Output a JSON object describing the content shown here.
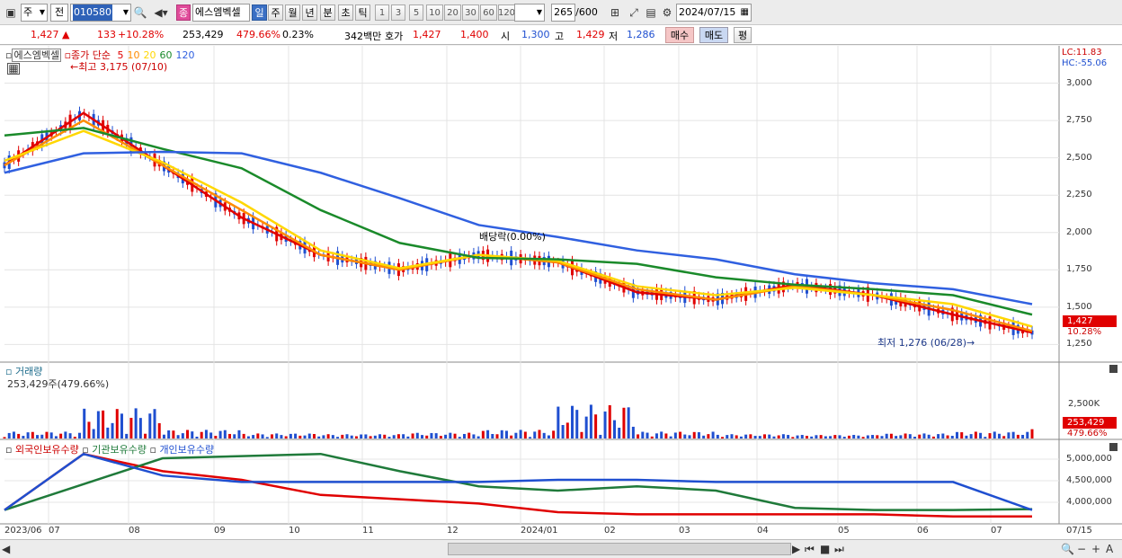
{
  "toolbar": {
    "period_type": "주",
    "prev_label": "전",
    "code": "010580",
    "name_badge": "종",
    "stock_name": "에스엠벡셀",
    "periods": [
      "일",
      "주",
      "월",
      "년",
      "분",
      "초",
      "틱"
    ],
    "selected_period": "일",
    "numbers": [
      "1",
      "3",
      "5",
      "10",
      "20",
      "30",
      "60",
      "120"
    ],
    "count": "265",
    "count_total": "/600",
    "date": "2024/07/15"
  },
  "quote": {
    "price": "1,427",
    "arrow": "▲",
    "change": "133",
    "change_pct": "+10.28%",
    "volume": "253,429",
    "volume_pct": "479.66%",
    "turnover": "0.23%",
    "amount": "342백만",
    "ask_label": "호가",
    "ask": "1,427",
    "bid": "1,400",
    "open_label": "시",
    "open": "1,300",
    "high_label": "고",
    "high": "1,429",
    "low_label": "저",
    "low": "1,286",
    "buy_label": "매수",
    "sell_label": "매도",
    "avg_label": "평"
  },
  "price_panel": {
    "legend_name": "에스엠벡셀",
    "legend_ma": "종가 단순",
    "ma_periods": [
      "5",
      "10",
      "20",
      "60",
      "120"
    ],
    "ma_colors": [
      "#e00000",
      "#ff8c00",
      "#ffd700",
      "#1a8a2a",
      "#3060e0"
    ],
    "high_note": "최고 3,175 (07/10)",
    "low_note": "최저 1,276 (06/28)",
    "div_note": "배당락(0.00%)",
    "lc": "LC:11.83",
    "hc": "HC:-55.06",
    "y_ticks": [
      "3,000",
      "2,750",
      "2,500",
      "2,250",
      "2,000",
      "1,750",
      "1,500",
      "1,250"
    ],
    "price_flag": "1,427",
    "pct_flag": "10.28%"
  },
  "volume_panel": {
    "title": "거래량",
    "value": "253,429주(479.66%)",
    "y_tick": "2,500K",
    "flag": "253,429",
    "flag_pct": "479.66%"
  },
  "holding_panel": {
    "t1": "외국인보유수량",
    "t2": "기관보유수량",
    "t3": "개인보유수량",
    "y_ticks": [
      "5,000,000",
      "4,500,000",
      "4,000,000"
    ]
  },
  "x_labels": [
    "2023/06",
    "07",
    "08",
    "09",
    "10",
    "11",
    "12",
    "2024/01",
    "02",
    "03",
    "04",
    "05",
    "06",
    "07",
    "07/15"
  ],
  "chart_data": {
    "type": "line",
    "x": [
      "2023/06",
      "2023/07",
      "2023/08",
      "2023/09",
      "2023/10",
      "2023/11",
      "2023/12",
      "2024/01",
      "2024/02",
      "2024/03",
      "2024/04",
      "2024/05",
      "2024/06",
      "2024/07"
    ],
    "series": [
      {
        "name": "5",
        "values": [
          2450,
          2800,
          2450,
          2100,
          1850,
          1750,
          1850,
          1800,
          1600,
          1550,
          1650,
          1580,
          1450,
          1330
        ]
      },
      {
        "name": "10",
        "values": [
          2450,
          2750,
          2450,
          2150,
          1850,
          1750,
          1850,
          1800,
          1620,
          1550,
          1640,
          1580,
          1480,
          1340
        ]
      },
      {
        "name": "20",
        "values": [
          2480,
          2680,
          2470,
          2200,
          1880,
          1760,
          1850,
          1810,
          1640,
          1580,
          1630,
          1580,
          1520,
          1370
        ]
      },
      {
        "name": "60",
        "values": [
          2650,
          2700,
          2560,
          2430,
          2150,
          1930,
          1830,
          1820,
          1790,
          1700,
          1650,
          1620,
          1580,
          1450
        ]
      },
      {
        "name": "120",
        "values": [
          2400,
          2530,
          2540,
          2530,
          2400,
          2230,
          2050,
          1970,
          1880,
          1820,
          1720,
          1660,
          1620,
          1520
        ]
      }
    ],
    "volume_k": [
      150,
      800,
      200,
      100,
      80,
      120,
      200,
      900,
      150,
      80,
      60,
      100,
      150,
      253
    ],
    "holdings": [
      {
        "name": "외국인보유수량",
        "values": [
          3800000,
          5100000,
          4700000,
          4500000,
          4150000,
          4050000,
          3950000,
          3750000,
          3700000,
          3700000,
          3700000,
          3700000,
          3650000,
          3650000
        ]
      },
      {
        "name": "기관보유수량",
        "values": [
          3800000,
          4400000,
          5000000,
          5050000,
          5100000,
          4700000,
          4350000,
          4250000,
          4350000,
          4250000,
          3850000,
          3800000,
          3800000,
          3820000
        ]
      },
      {
        "name": "개인보유수량",
        "values": [
          3800000,
          5100000,
          4600000,
          4450000,
          4450000,
          4450000,
          4450000,
          4500000,
          4500000,
          4450000,
          4450000,
          4450000,
          4450000,
          3800000
        ]
      }
    ],
    "ylim": [
      1150,
      3250
    ]
  }
}
